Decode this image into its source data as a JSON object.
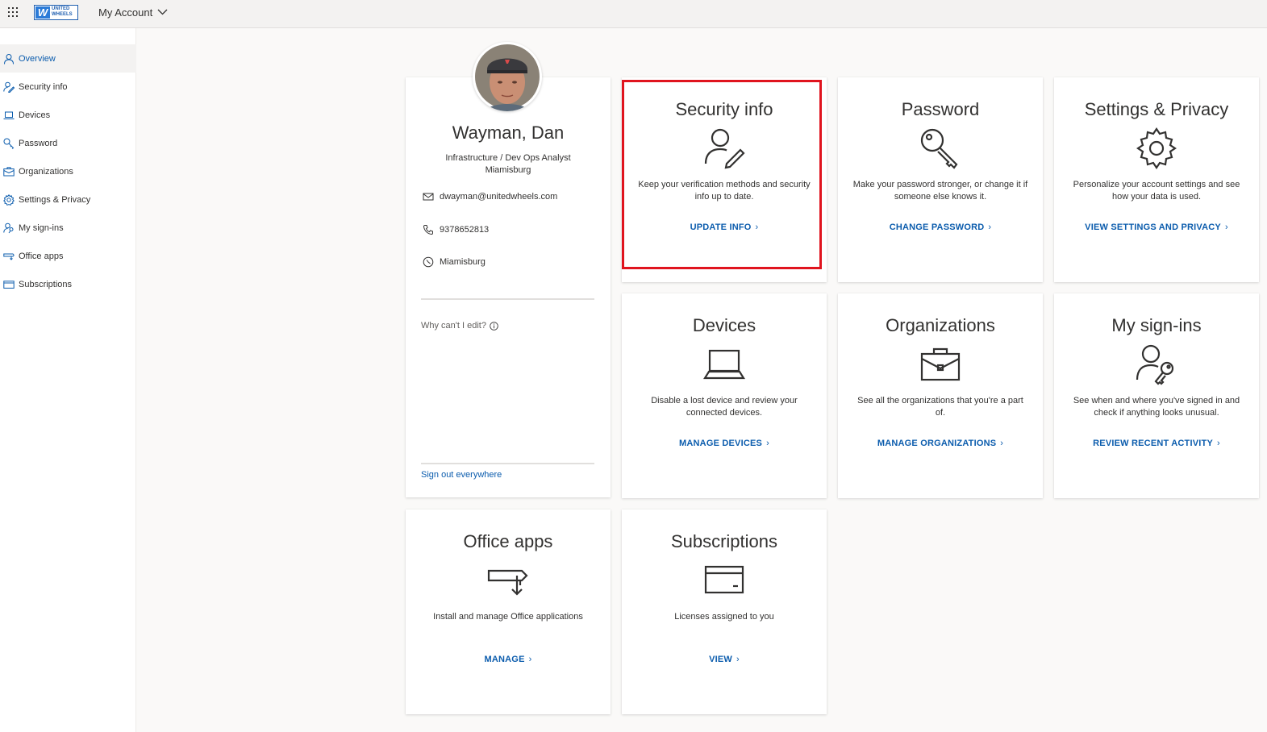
{
  "header": {
    "app_title": "My Account",
    "logo": {
      "mark": "W",
      "line1": "UNITED",
      "line2": "WHEELS"
    }
  },
  "sidebar": {
    "items": [
      {
        "label": "Overview",
        "icon": "person-icon",
        "active": true
      },
      {
        "label": "Security info",
        "icon": "person-edit-icon"
      },
      {
        "label": "Devices",
        "icon": "laptop-icon"
      },
      {
        "label": "Password",
        "icon": "key-icon"
      },
      {
        "label": "Organizations",
        "icon": "briefcase-icon"
      },
      {
        "label": "Settings & Privacy",
        "icon": "gear-icon"
      },
      {
        "label": "My sign-ins",
        "icon": "person-key-icon"
      },
      {
        "label": "Office apps",
        "icon": "office-apps-icon"
      },
      {
        "label": "Subscriptions",
        "icon": "card-icon"
      }
    ]
  },
  "profile": {
    "name": "Wayman, Dan",
    "job_title": "Infrastructure / Dev Ops Analyst",
    "location_line": "Miamisburg",
    "email": "dwayman@unitedwheels.com",
    "phone": "9378652813",
    "office": "Miamisburg",
    "why_edit": "Why can't I edit?",
    "sign_out": "Sign out everywhere"
  },
  "tiles": {
    "security": {
      "title": "Security info",
      "desc": "Keep your verification methods and security info up to date.",
      "link": "UPDATE INFO"
    },
    "password": {
      "title": "Password",
      "desc": "Make your password stronger, or change it if someone else knows it.",
      "link": "CHANGE PASSWORD"
    },
    "settings": {
      "title": "Settings & Privacy",
      "desc": "Personalize your account settings and see how your data is used.",
      "link": "VIEW SETTINGS AND PRIVACY"
    },
    "devices": {
      "title": "Devices",
      "desc": "Disable a lost device and review your connected devices.",
      "link": "MANAGE DEVICES"
    },
    "organizations": {
      "title": "Organizations",
      "desc": "See all the organizations that you're a part of.",
      "link": "MANAGE ORGANIZATIONS"
    },
    "signins": {
      "title": "My sign-ins",
      "desc": "See when and where you've signed in and check if anything looks unusual.",
      "link": "REVIEW RECENT ACTIVITY"
    },
    "officeapps": {
      "title": "Office apps",
      "desc": "Install and manage Office applications",
      "link": "MANAGE"
    },
    "subscriptions": {
      "title": "Subscriptions",
      "desc": "Licenses assigned to you",
      "link": "VIEW"
    }
  },
  "colors": {
    "accent": "#0b5cad",
    "highlight": "#e0141e",
    "page_bg": "#faf9f8"
  }
}
